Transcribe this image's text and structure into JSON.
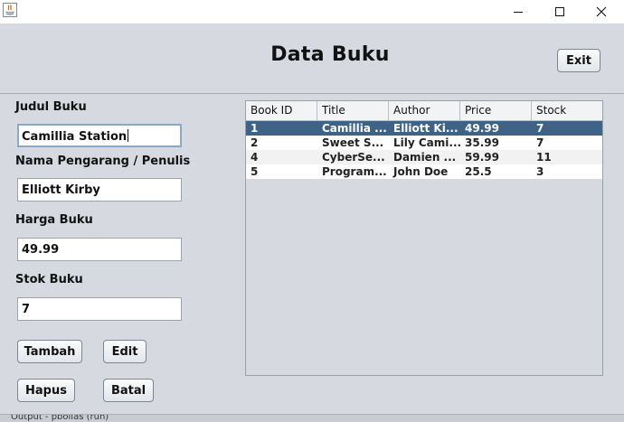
{
  "window": {
    "title": ""
  },
  "header": {
    "title": "Data Buku",
    "exit_label": "Exit"
  },
  "form": {
    "judul_label": "Judul Buku",
    "judul_value": "Camillia Station",
    "penulis_label": "Nama Pengarang / Penulis",
    "penulis_value": "Elliott Kirby",
    "harga_label": "Harga Buku",
    "harga_value": "49.99",
    "stok_label": "Stok Buku",
    "stok_value": "7"
  },
  "buttons": {
    "tambah": "Tambah",
    "edit": "Edit",
    "hapus": "Hapus",
    "batal": "Batal"
  },
  "table": {
    "columns": [
      "Book ID",
      "Title",
      "Author",
      "Price",
      "Stock"
    ],
    "rows": [
      [
        "1",
        "Camillia ...",
        "Elliott Ki...",
        "49.99",
        "7"
      ],
      [
        "2",
        "Sweet S...",
        "Lily Cami...",
        "35.99",
        "7"
      ],
      [
        "4",
        "CyberSe...",
        "Damien ...",
        "59.99",
        "11"
      ],
      [
        "5",
        "Program...",
        "John Doe",
        "25.5",
        "3"
      ]
    ],
    "selected_row": 0
  },
  "statusbar": {
    "text": "Output - pbollas (run)"
  },
  "colors": {
    "selection": "#3e6387",
    "background": "#d6d9df"
  }
}
